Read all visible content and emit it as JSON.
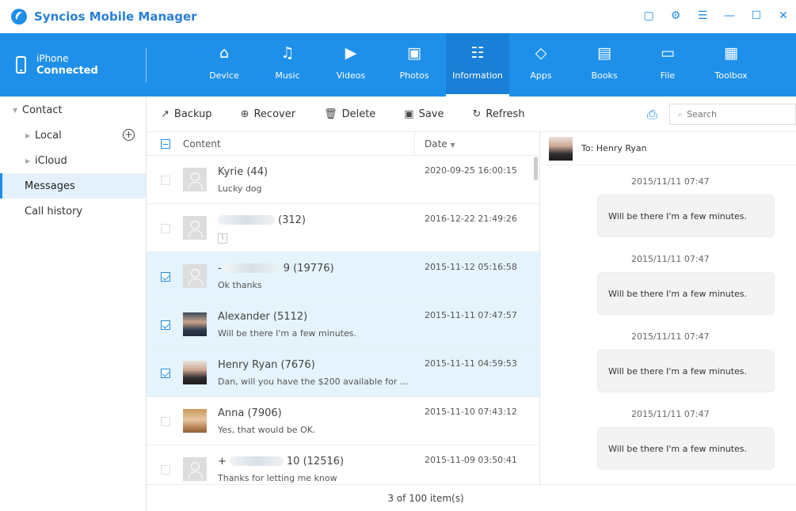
{
  "app": {
    "title": "Syncios Mobile Manager"
  },
  "device": {
    "name": "iPhone",
    "status": "Connected"
  },
  "nav": [
    {
      "label": "Device",
      "icon": "home-icon"
    },
    {
      "label": "Music",
      "icon": "music-icon"
    },
    {
      "label": "Videos",
      "icon": "video-icon"
    },
    {
      "label": "Photos",
      "icon": "photo-icon"
    },
    {
      "label": "Information",
      "icon": "contact-card-icon",
      "active": true
    },
    {
      "label": "Apps",
      "icon": "apps-icon"
    },
    {
      "label": "Books",
      "icon": "book-icon"
    },
    {
      "label": "File",
      "icon": "folder-icon"
    },
    {
      "label": "Toolbox",
      "icon": "toolbox-icon"
    }
  ],
  "sidebar": {
    "contact": "Contact",
    "local": "Local",
    "icloud": "iCloud",
    "messages": "Messages",
    "call_history": "Call history"
  },
  "toolbar": {
    "backup": "Backup",
    "recover": "Recover",
    "delete": "Delete",
    "save": "Save",
    "refresh": "Refresh",
    "search_placeholder": "Search"
  },
  "list": {
    "header_content": "Content",
    "header_date": "Date",
    "rows": [
      {
        "name": "Kyrie (44)",
        "preview": "Lucky dog",
        "date": "2020-09-25 16:00:15",
        "checked": false
      },
      {
        "name": "(312)",
        "preview": "",
        "date": "2016-12-22 21:49:26",
        "checked": false
      },
      {
        "name": "9 (19776)",
        "preview": "Ok thanks",
        "date": "2015-11-12 05:16:58",
        "checked": true
      },
      {
        "name": "Alexander (5112)",
        "preview": "Will be there I'm a few minutes.",
        "date": "2015-11-11 07:47:57",
        "checked": true
      },
      {
        "name": "Henry Ryan (7676)",
        "preview": "Dan, will you have the $200 available for me...",
        "date": "2015-11-11 04:59:53",
        "checked": true
      },
      {
        "name": "Anna (7906)",
        "preview": "Yes, that would be OK.",
        "date": "2015-11-10 07:43:12",
        "checked": false
      },
      {
        "name": "10 (12516)",
        "preview": "Thanks for letting me know",
        "date": "2015-11-09 03:50:41",
        "checked": false
      }
    ]
  },
  "footer": {
    "count": "3 of 100 item(s)"
  },
  "conversation": {
    "to": "To: Henry Ryan",
    "messages": [
      {
        "time": "2015/11/11 07:47",
        "text": "Will be there I'm a few minutes."
      },
      {
        "time": "2015/11/11 07:47",
        "text": "Will be there I'm a few minutes."
      },
      {
        "time": "2015/11/11 07:47",
        "text": "Will be there I'm a few minutes."
      },
      {
        "time": "2015/11/11 07:47",
        "text": "Will be there I'm a few minutes."
      }
    ]
  },
  "colors": {
    "accent": "#1e8ee8",
    "selected_row": "#e4f3fc"
  }
}
